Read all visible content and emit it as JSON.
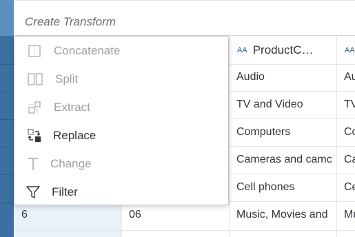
{
  "toolbar": {
    "input_placeholder": "Create Transform"
  },
  "menu": {
    "items": [
      {
        "label": "Concatenate",
        "icon": "concatenate-icon",
        "enabled": false
      },
      {
        "label": "Split",
        "icon": "split-icon",
        "enabled": false
      },
      {
        "label": "Extract",
        "icon": "extract-icon",
        "enabled": false
      },
      {
        "label": "Replace",
        "icon": "replace-icon",
        "enabled": true
      },
      {
        "label": "Change",
        "icon": "change-icon",
        "enabled": false
      },
      {
        "label": "Filter",
        "icon": "filter-icon",
        "enabled": true
      }
    ]
  },
  "grid": {
    "headers": [
      {
        "type_badge": "AA",
        "label": "ProductC…"
      },
      {
        "type_badge": "AA",
        "label": ""
      }
    ],
    "rows": [
      {
        "col3": "Audio",
        "col4": "Au"
      },
      {
        "col3": "TV and Video",
        "col4": "TV"
      },
      {
        "col3": "Computers",
        "col4": "Co"
      },
      {
        "col3": "Cameras and camc",
        "col4": "Ca"
      },
      {
        "col3": "Cell phones",
        "col4": "Ce"
      },
      {
        "col1": "6",
        "col2": "06",
        "col3": "Music, Movies and",
        "col4": "Mu"
      }
    ]
  },
  "colors": {
    "accent": "#3e6fa3",
    "selected": "#eaf1f7",
    "disabled": "#9ea0a2"
  }
}
